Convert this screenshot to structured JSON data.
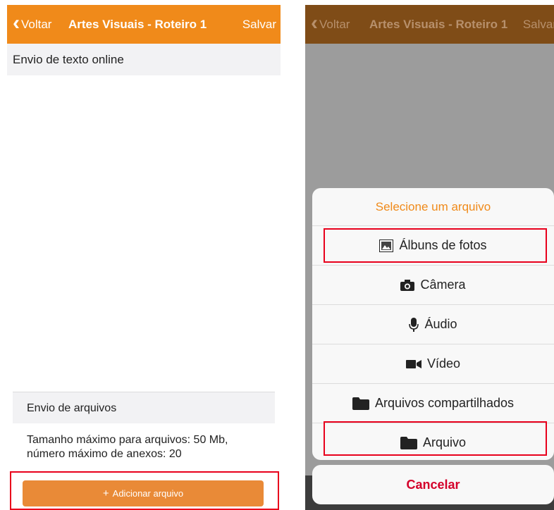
{
  "left": {
    "nav": {
      "back_label": "Voltar",
      "title": "Artes Visuais - Roteiro 1",
      "save_label": "Salvar"
    },
    "text_section_header": "Envio de texto online",
    "files_section_header": "Envio de arquivos",
    "limits_text": "Tamanho máximo para arquivos: 50 Mb, número máximo de anexos: 20",
    "add_button": {
      "icon": "plus-icon",
      "label": "Adicionar arquivo"
    }
  },
  "right": {
    "nav": {
      "back_label": "Voltar",
      "title": "Artes Visuais - Roteiro 1",
      "save_label": "Salvar"
    },
    "sheet": {
      "title": "Selecione um arquivo",
      "items": [
        {
          "icon": "photo-album-icon",
          "label": "Álbuns de fotos"
        },
        {
          "icon": "camera-icon",
          "label": "Câmera"
        },
        {
          "icon": "microphone-icon",
          "label": "Áudio"
        },
        {
          "icon": "video-camera-icon",
          "label": "Vídeo"
        },
        {
          "icon": "folder-icon",
          "label": "Arquivos compartilhados"
        },
        {
          "icon": "folder-icon",
          "label": "Arquivo"
        }
      ],
      "cancel_label": "Cancelar"
    }
  },
  "colors": {
    "accent": "#f08a1a",
    "button": "#e98a37",
    "cancel": "#d4002a",
    "highlight": "#e8001c"
  }
}
